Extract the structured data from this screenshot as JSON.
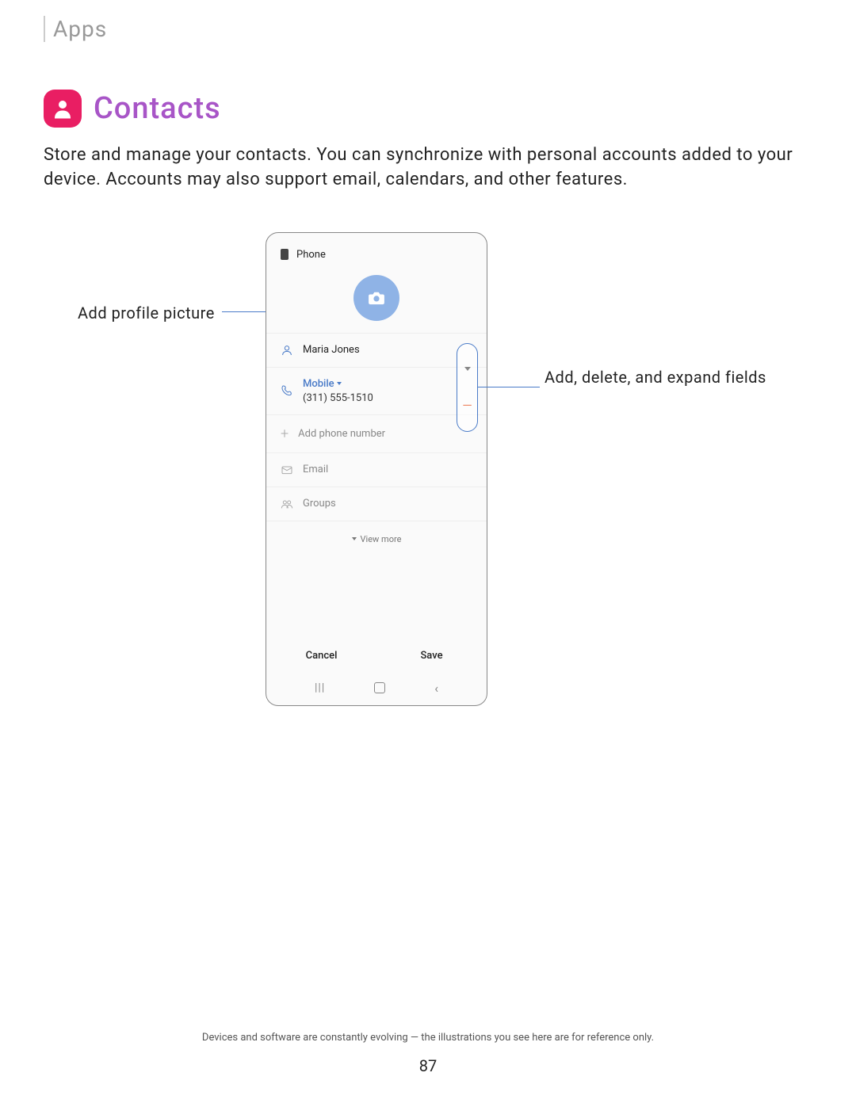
{
  "section": "Apps",
  "title": "Contacts",
  "description": "Store and manage your contacts. You can synchronize with personal accounts added to your device. Accounts may also support email, calendars, and other features.",
  "callouts": {
    "left": "Add profile picture",
    "right": "Add, delete, and expand fields"
  },
  "phone": {
    "storage": "Phone",
    "name": "Maria Jones",
    "phone_type": "Mobile",
    "phone_number": "(311) 555-1510",
    "add_phone": "Add phone number",
    "email": "Email",
    "groups": "Groups",
    "view_more": "View more",
    "cancel": "Cancel",
    "save": "Save"
  },
  "footnote": "Devices and software are constantly evolving — the illustrations you see here are for reference only.",
  "page": "87"
}
